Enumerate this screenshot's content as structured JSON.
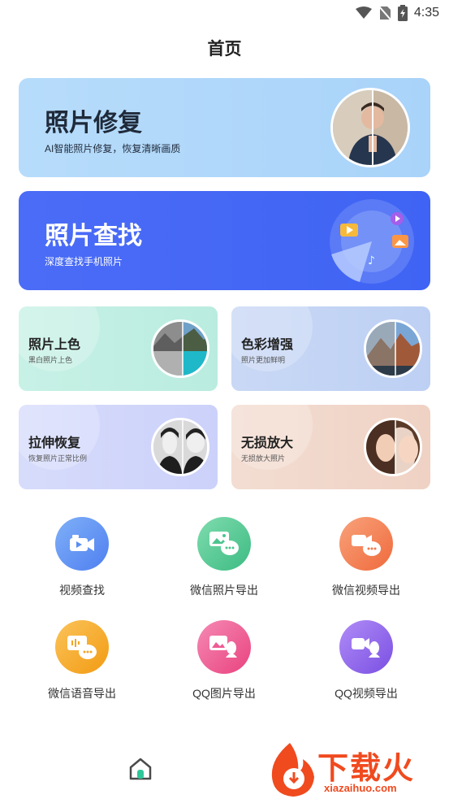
{
  "status_bar": {
    "time": "4:35",
    "icons": [
      "wifi-icon",
      "no-sim-icon",
      "battery-icon"
    ]
  },
  "header": {
    "title": "首页"
  },
  "hero_cards": [
    {
      "title": "照片修复",
      "subtitle": "AI智能照片修复，恢复清晰画质"
    },
    {
      "title": "照片查找",
      "subtitle": "深度查找手机照片"
    }
  ],
  "feature_cards": [
    {
      "title": "照片上色",
      "subtitle": "黑白照片上色"
    },
    {
      "title": "色彩增强",
      "subtitle": "照片更加鲜明"
    },
    {
      "title": "拉伸恢复",
      "subtitle": "恢复照片正常比例"
    },
    {
      "title": "无损放大",
      "subtitle": "无损放大照片"
    }
  ],
  "tools": [
    {
      "label": "视频查找",
      "icon": "video-camera-icon",
      "color": "#5b8ef2"
    },
    {
      "label": "微信照片导出",
      "icon": "wechat-photo-icon",
      "color": "#4cc48e"
    },
    {
      "label": "微信视频导出",
      "icon": "wechat-video-icon",
      "color": "#f2784b"
    },
    {
      "label": "微信语音导出",
      "icon": "wechat-voice-icon",
      "color": "#f5a524"
    },
    {
      "label": "QQ图片导出",
      "icon": "qq-photo-icon",
      "color": "#ef5b94"
    },
    {
      "label": "QQ视频导出",
      "icon": "qq-video-icon",
      "color": "#8a63e8"
    }
  ],
  "bottom_nav": {
    "items": [
      "home-icon"
    ]
  },
  "watermark": {
    "text": "下载火",
    "url": "xiazaihuo.com"
  },
  "colors": {
    "accent_blue": "#3f63f4",
    "home_icon_green": "#2fc79a"
  }
}
